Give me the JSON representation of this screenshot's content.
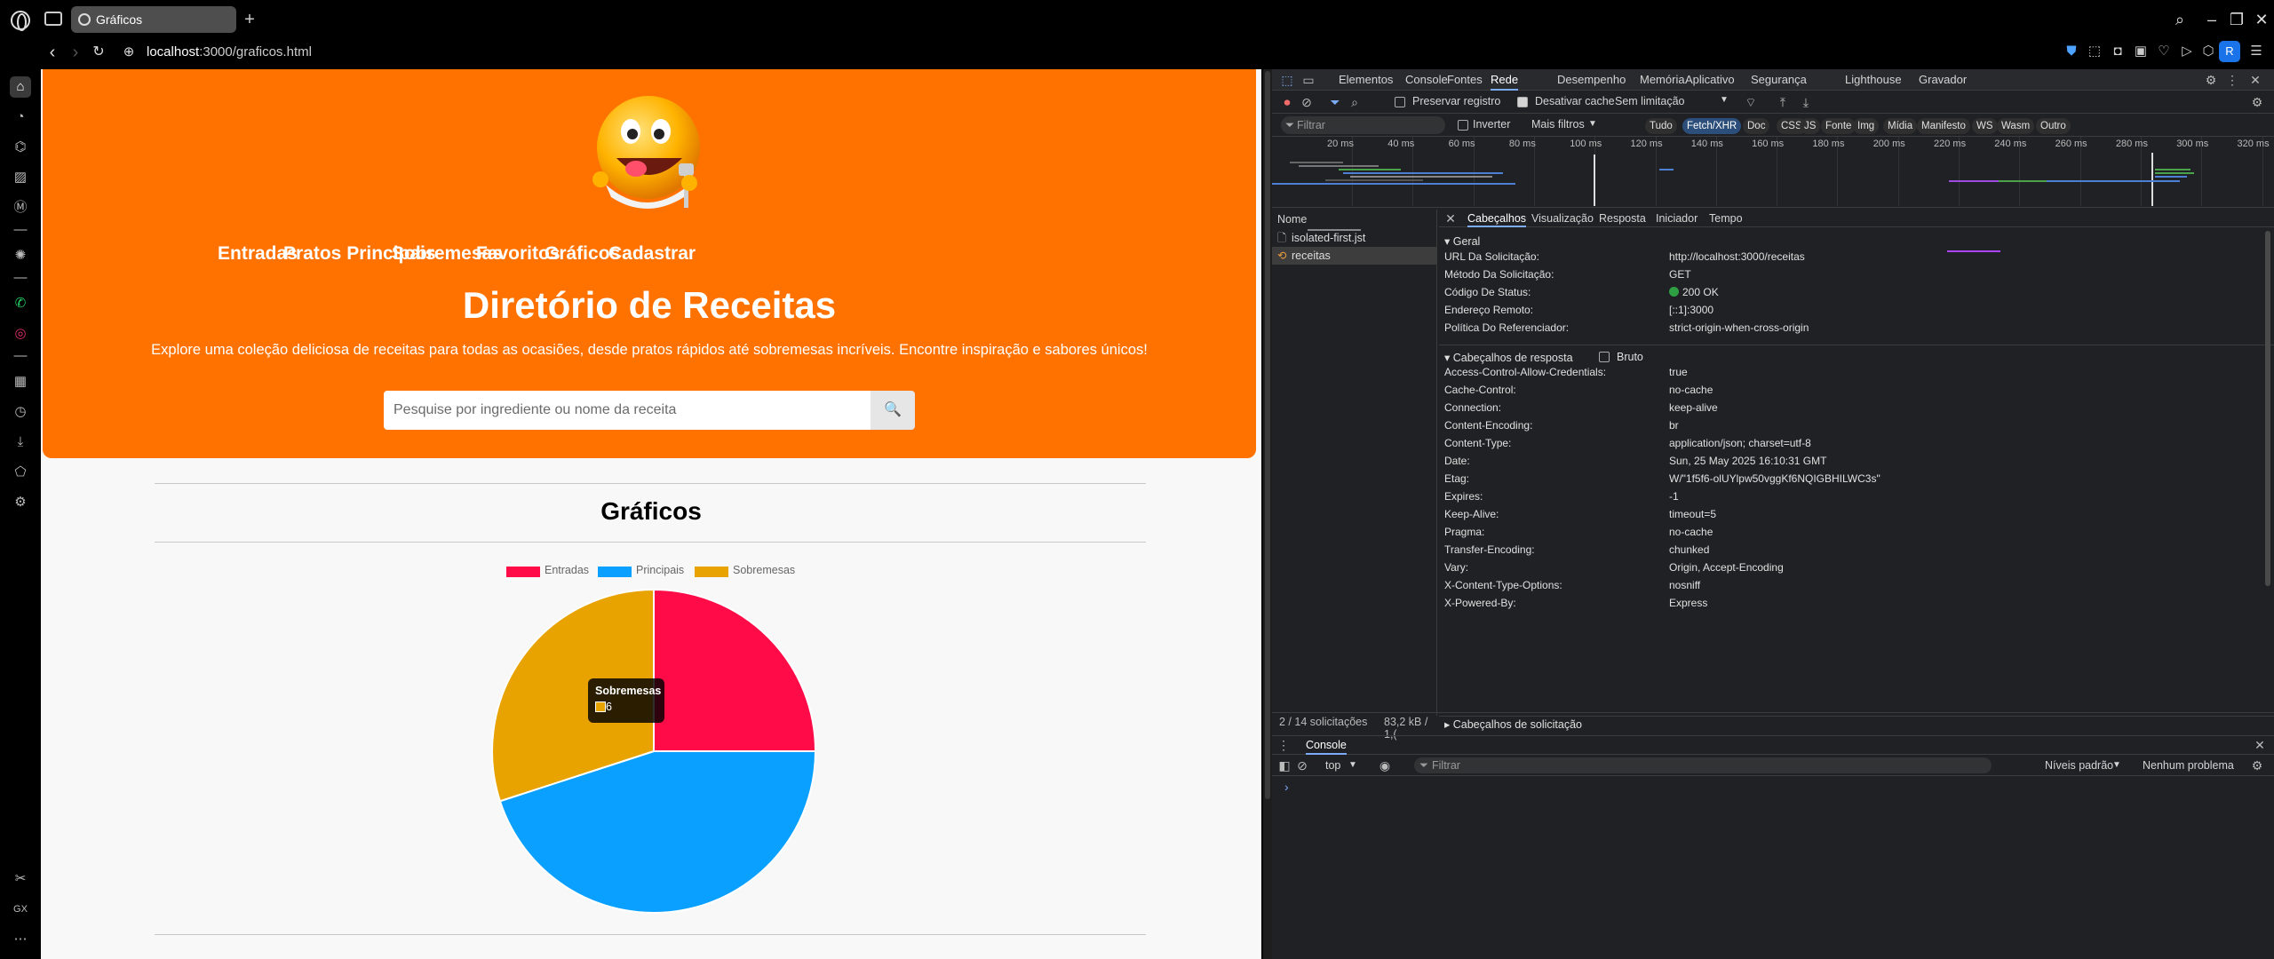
{
  "browser": {
    "tab_title": "Gráficos",
    "url_host": "localhost",
    "url_rest": ":3000/graficos.html",
    "profile_initial": "R"
  },
  "site": {
    "nav": [
      "Entradas",
      "Pratos Principais",
      "Sobremesas",
      "Favoritos",
      "Gráficos",
      "Cadastrar"
    ],
    "title": "Diretório de Receitas",
    "tagline": "Explore uma coleção deliciosa de receitas para todas as ocasiões, desde pratos rápidos até sobremesas incríveis. Encontre inspiração e sabores únicos!",
    "search_placeholder": "Pesquise por ingrediente ou nome da receita",
    "section_title": "Gráficos",
    "colors": {
      "brand": "#ff7200",
      "entradas": "#ff0b48",
      "principais": "#0aa0ff",
      "sobremesas": "#e8a300"
    }
  },
  "chart_data": {
    "type": "pie",
    "title": "",
    "categories": [
      "Entradas",
      "Principais",
      "Sobremesas"
    ],
    "values": [
      5,
      9,
      6
    ],
    "colors": [
      "#ff0b48",
      "#0aa0ff",
      "#e8a300"
    ],
    "legend": "top",
    "tooltip": {
      "label": "Sobremesas",
      "value": "6"
    }
  },
  "devtools": {
    "tabs": [
      "Elementos",
      "Console",
      "Fontes",
      "Rede",
      "Desempenho",
      "Memória",
      "Aplicativo",
      "Segurança",
      "Lighthouse",
      "Gravador"
    ],
    "active_tab": "Rede",
    "toolbar": {
      "preserve": "Preservar registro",
      "disable_cache": "Desativar cache",
      "throttle": "Sem limitação"
    },
    "filter_placeholder": "Filtrar",
    "invert": "Inverter",
    "more_filters": "Mais filtros",
    "chips": [
      "Tudo",
      "Fetch/XHR",
      "Doc",
      "CSS",
      "JS",
      "Fonte",
      "Img",
      "Mídia",
      "Manifesto",
      "WS",
      "Wasm",
      "Outro"
    ],
    "active_chip": "Fetch/XHR",
    "ticks": [
      "20 ms",
      "40 ms",
      "60 ms",
      "80 ms",
      "100 ms",
      "120 ms",
      "140 ms",
      "160 ms",
      "180 ms",
      "200 ms",
      "220 ms",
      "240 ms",
      "260 ms",
      "280 ms",
      "300 ms",
      "320 ms"
    ],
    "name_header": "Nome",
    "requests": [
      "isolated-first.jst",
      "receitas"
    ],
    "summary": "2 / 14 solicitações",
    "size_summary": "83,2 kB / 1,(",
    "detail_tabs": [
      "Cabeçalhos",
      "Visualização",
      "Resposta",
      "Iniciador",
      "Tempo"
    ],
    "general_title": "Geral",
    "general": [
      {
        "k": "URL Da Solicitação:",
        "v": "http://localhost:3000/receitas"
      },
      {
        "k": "Método Da Solicitação:",
        "v": "GET"
      },
      {
        "k": "Código De Status:",
        "v": "200 OK"
      },
      {
        "k": "Endereço Remoto:",
        "v": "[::1]:3000"
      },
      {
        "k": "Política Do Referenciador:",
        "v": "strict-origin-when-cross-origin"
      }
    ],
    "response_title": "Cabeçalhos de resposta",
    "raw": "Bruto",
    "response": [
      {
        "k": "Access-Control-Allow-Credentials:",
        "v": "true"
      },
      {
        "k": "Cache-Control:",
        "v": "no-cache"
      },
      {
        "k": "Connection:",
        "v": "keep-alive"
      },
      {
        "k": "Content-Encoding:",
        "v": "br"
      },
      {
        "k": "Content-Type:",
        "v": "application/json; charset=utf-8"
      },
      {
        "k": "Date:",
        "v": "Sun, 25 May 2025 16:10:31 GMT"
      },
      {
        "k": "Etag:",
        "v": "W/\"1f5f6-olUYlpw50vggKf6NQIGBHILWC3s\""
      },
      {
        "k": "Expires:",
        "v": "-1"
      },
      {
        "k": "Keep-Alive:",
        "v": "timeout=5"
      },
      {
        "k": "Pragma:",
        "v": "no-cache"
      },
      {
        "k": "Transfer-Encoding:",
        "v": "chunked"
      },
      {
        "k": "Vary:",
        "v": "Origin, Accept-Encoding"
      },
      {
        "k": "X-Content-Type-Options:",
        "v": "nosniff"
      },
      {
        "k": "X-Powered-By:",
        "v": "Express"
      }
    ],
    "request_headers_title": "Cabeçalhos de solicitação",
    "console": {
      "tab": "Console",
      "context": "top",
      "filter": "Filtrar",
      "levels": "Níveis padrão",
      "issues": "Nenhum problema",
      "prompt": "›"
    }
  }
}
